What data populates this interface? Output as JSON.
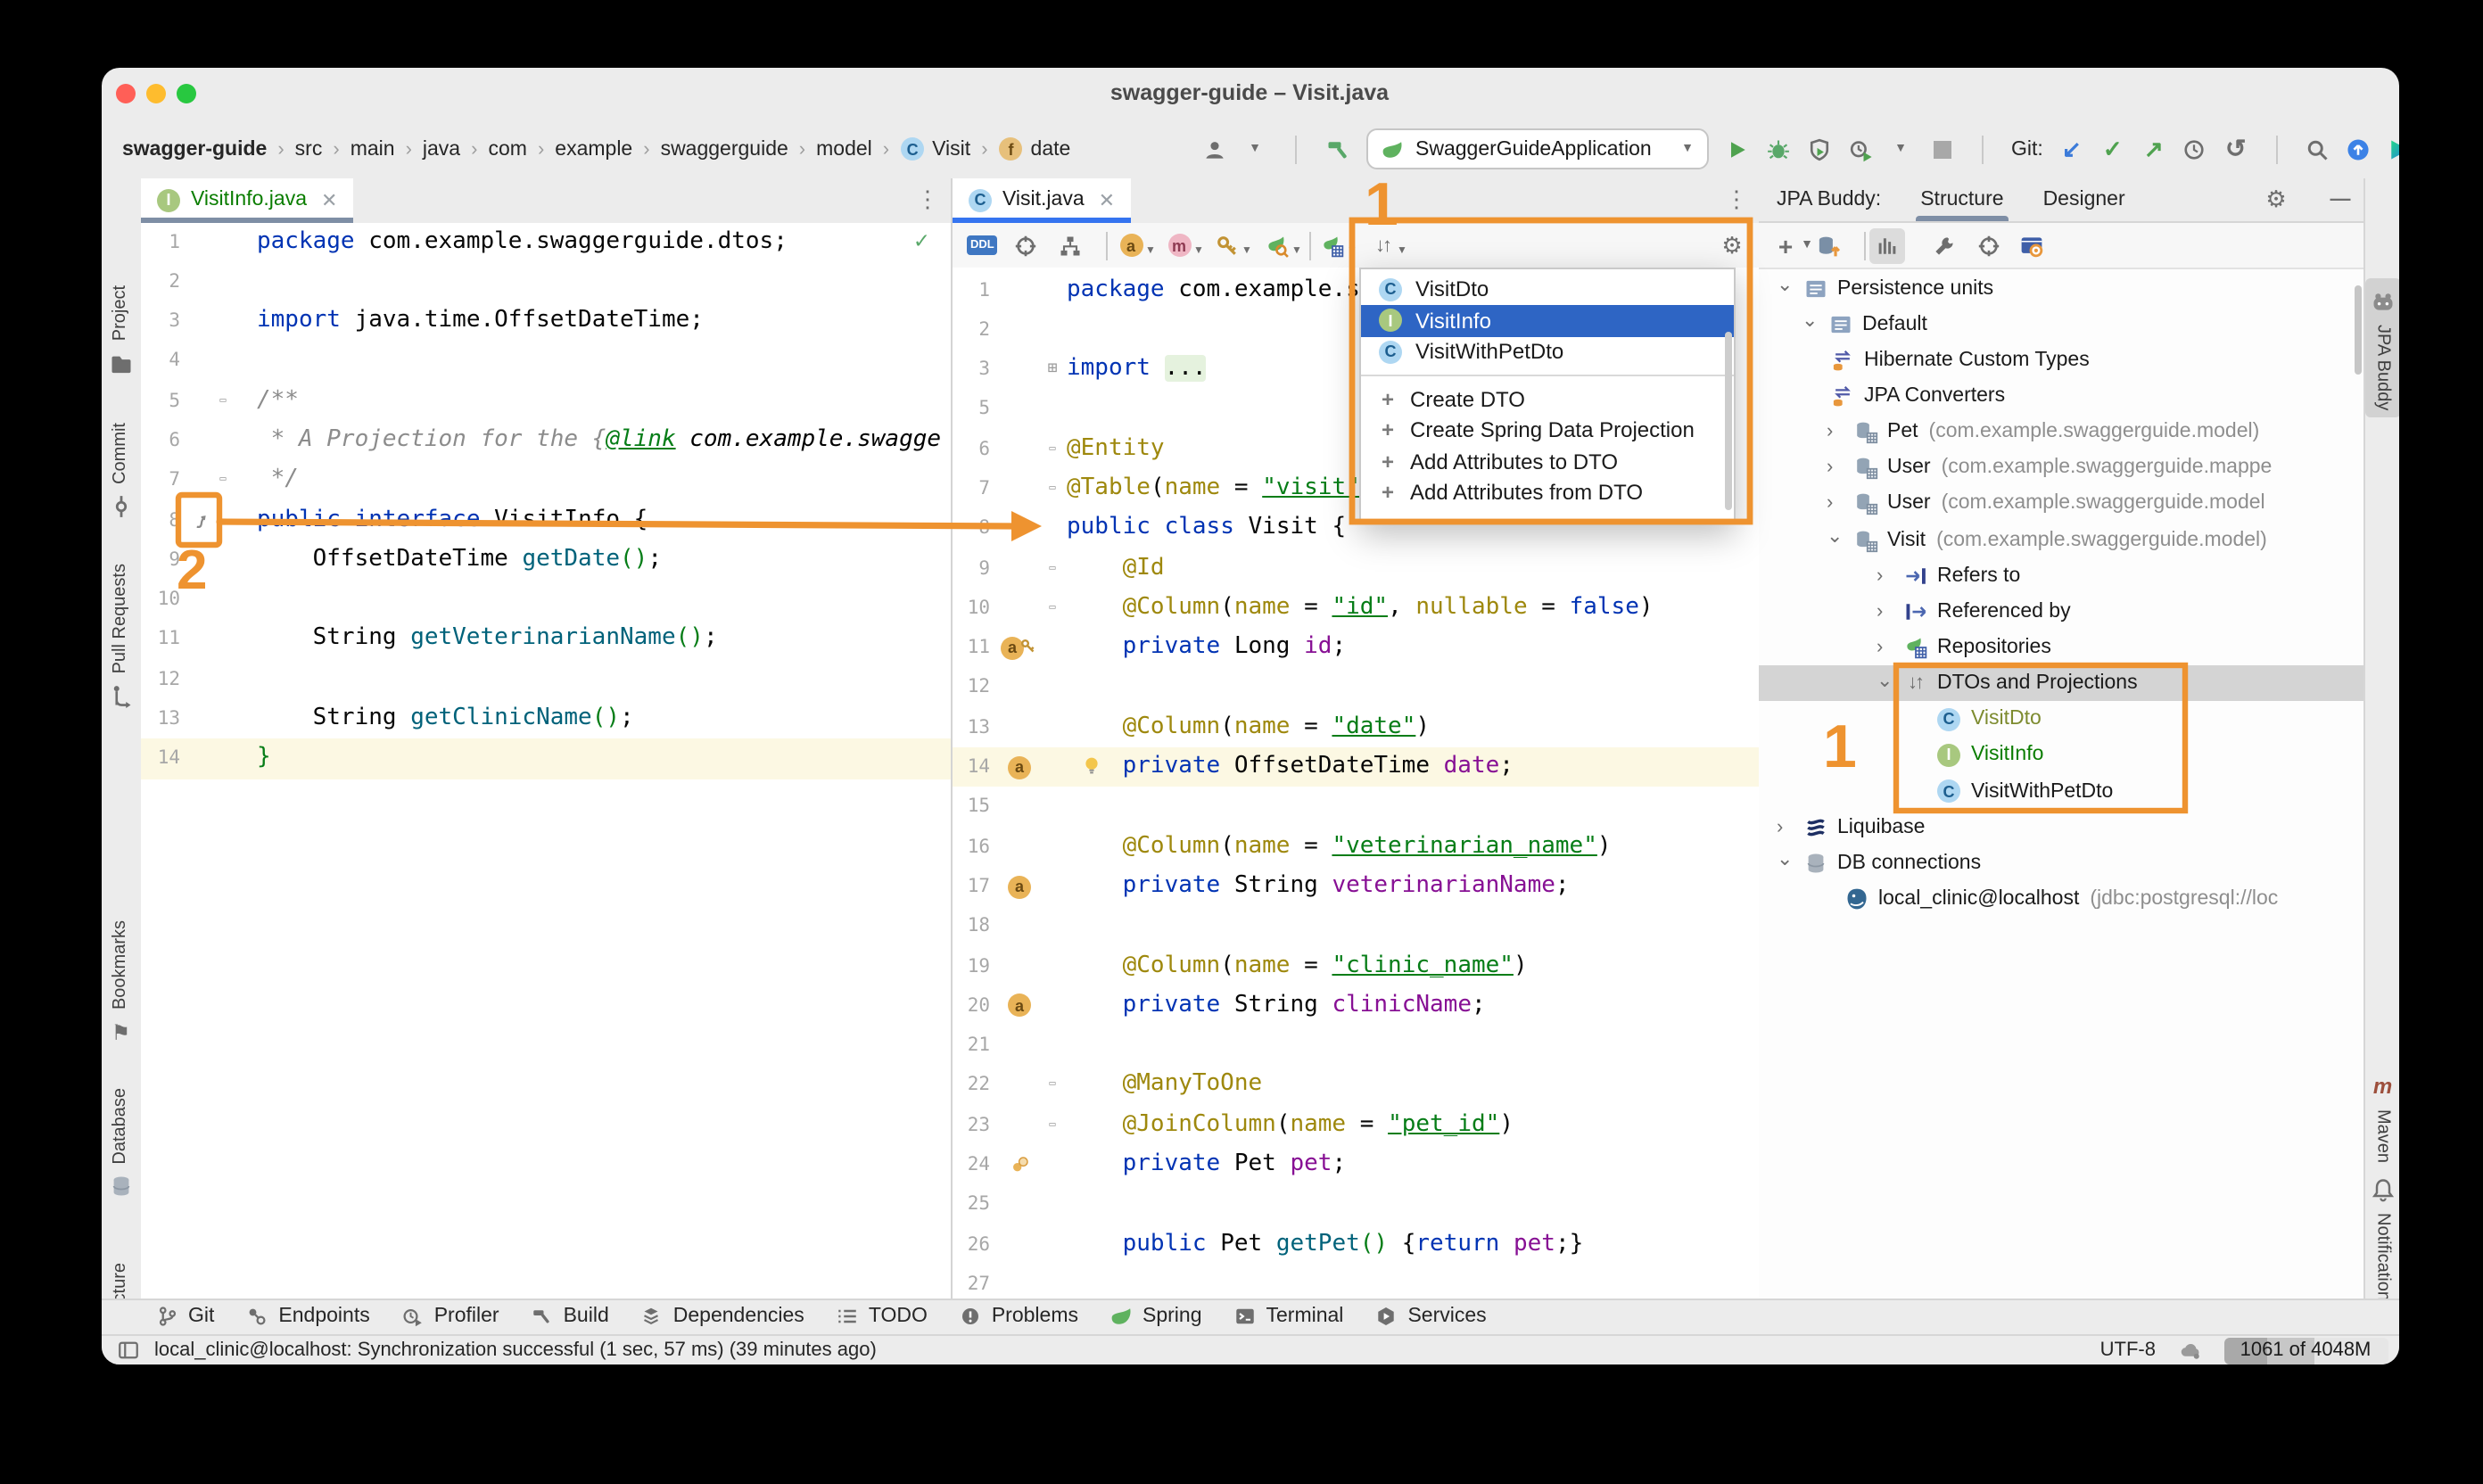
{
  "window_title": "swagger-guide – Visit.java",
  "breadcrumbs": [
    {
      "label": "swagger-guide",
      "bold": true
    },
    {
      "label": "src"
    },
    {
      "label": "main"
    },
    {
      "label": "java"
    },
    {
      "label": "com"
    },
    {
      "label": "example"
    },
    {
      "label": "swaggerguide"
    },
    {
      "label": "model"
    },
    {
      "label": "Visit",
      "icon": "class-c"
    },
    {
      "label": "date",
      "icon": "field-f"
    }
  ],
  "toolbar": {
    "git_label": "Git:",
    "run_config": "SwaggerGuideApplication"
  },
  "left_stripe": [
    {
      "label": "Project",
      "icon": "folder"
    },
    {
      "label": "Commit",
      "icon": "commit"
    },
    {
      "label": "Pull Requests",
      "icon": "pull-request"
    },
    {
      "label": "Bookmarks",
      "icon": "bookmark"
    },
    {
      "label": "Database",
      "icon": "db"
    },
    {
      "label": "Structure",
      "icon": "structure"
    }
  ],
  "right_stripe": [
    {
      "label": "JPA Buddy",
      "icon": "jpa-buddy",
      "selected": true
    },
    {
      "label": "Maven",
      "icon": "maven"
    },
    {
      "label": "Notifications",
      "icon": "bell"
    }
  ],
  "left_editor": {
    "tab": "VisitInfo.java",
    "lines": [
      {
        "n": "1",
        "t": [
          [
            "k",
            "package"
          ],
          [
            "d",
            " com.example.swaggerguide.dtos;"
          ]
        ],
        "check": true
      },
      {
        "n": "2",
        "t": []
      },
      {
        "n": "3",
        "t": [
          [
            "k",
            "import"
          ],
          [
            "d",
            " java.time.OffsetDateTime;"
          ]
        ]
      },
      {
        "n": "4",
        "t": []
      },
      {
        "n": "5",
        "t": [
          [
            "c",
            "/**"
          ]
        ],
        "fold": "-"
      },
      {
        "n": "6",
        "t": [
          [
            "c",
            " * A Projection for the {"
          ],
          [
            "lk",
            "@link"
          ],
          [
            "it",
            " com.example.swagge"
          ]
        ]
      },
      {
        "n": "7",
        "t": [
          [
            "c",
            " */"
          ]
        ],
        "fold": "-"
      },
      {
        "n": "8",
        "t": [
          [
            "k",
            "public"
          ],
          [
            "d",
            " "
          ],
          [
            "k",
            "interface"
          ],
          [
            "d",
            " VisitInfo {"
          ]
        ],
        "badge": "snav"
      },
      {
        "n": "9",
        "t": [
          [
            "d",
            "    OffsetDateTime "
          ],
          [
            "m",
            "getDate"
          ],
          [
            "p",
            "()"
          ],
          [
            "d",
            ";"
          ]
        ]
      },
      {
        "n": "10",
        "t": []
      },
      {
        "n": "11",
        "t": [
          [
            "d",
            "    String "
          ],
          [
            "m",
            "getVeterinarianName"
          ],
          [
            "p",
            "()"
          ],
          [
            "d",
            ";"
          ]
        ]
      },
      {
        "n": "12",
        "t": []
      },
      {
        "n": "13",
        "t": [
          [
            "d",
            "    String "
          ],
          [
            "m",
            "getClinicName"
          ],
          [
            "p",
            "()"
          ],
          [
            "d",
            ";"
          ]
        ]
      },
      {
        "n": "14",
        "t": [
          [
            "p",
            "}"
          ]
        ],
        "hl": true
      }
    ]
  },
  "right_editor": {
    "tab": "Visit.java",
    "lines": [
      {
        "n": "1",
        "t": [
          [
            "k",
            "package"
          ],
          [
            "d",
            " com.example.s"
          ]
        ]
      },
      {
        "n": "2",
        "t": []
      },
      {
        "n": "3",
        "t": [
          [
            "k",
            "import "
          ],
          [
            "fold",
            "..."
          ]
        ],
        "fold": "+"
      },
      {
        "n": "5",
        "t": []
      },
      {
        "n": "6",
        "t": [
          [
            "a",
            "@Entity"
          ]
        ],
        "fold": "-"
      },
      {
        "n": "7",
        "t": [
          [
            "a",
            "@Table"
          ],
          [
            "d",
            "("
          ],
          [
            "a",
            "name"
          ],
          [
            "d",
            " = "
          ],
          [
            "su",
            "\"visit\""
          ]
        ],
        "fold": "-"
      },
      {
        "n": "8",
        "t": [
          [
            "k",
            "public"
          ],
          [
            "d",
            " "
          ],
          [
            "k",
            "class"
          ],
          [
            "d",
            " Visit {"
          ]
        ],
        "badge": "dbtable"
      },
      {
        "n": "9",
        "t": [
          [
            "a",
            "    @Id"
          ]
        ],
        "fold": "-"
      },
      {
        "n": "10",
        "t": [
          [
            "a",
            "    @Column"
          ],
          [
            "d",
            "("
          ],
          [
            "a",
            "name"
          ],
          [
            "d",
            " = "
          ],
          [
            "su",
            "\"id\""
          ],
          [
            "d",
            ", "
          ],
          [
            "a",
            "nullable"
          ],
          [
            "d",
            " = "
          ],
          [
            "k",
            "false"
          ],
          [
            "d",
            ")"
          ]
        ],
        "fold": "-"
      },
      {
        "n": "11",
        "t": [
          [
            "k",
            "    private"
          ],
          [
            "d",
            " Long "
          ],
          [
            "f",
            "id"
          ],
          [
            "d",
            ";"
          ]
        ],
        "badge": "a-key"
      },
      {
        "n": "12",
        "t": []
      },
      {
        "n": "13",
        "t": [
          [
            "a",
            "    @Column"
          ],
          [
            "d",
            "("
          ],
          [
            "a",
            "name"
          ],
          [
            "d",
            " = "
          ],
          [
            "su",
            "\"date\""
          ],
          [
            "d",
            ")"
          ]
        ]
      },
      {
        "n": "14",
        "t": [
          [
            "k",
            "    private"
          ],
          [
            "d",
            " OffsetDateTime "
          ],
          [
            "f",
            "date"
          ],
          [
            "d",
            ";"
          ]
        ],
        "hl": true,
        "badge": "a",
        "bulb": true
      },
      {
        "n": "15",
        "t": []
      },
      {
        "n": "16",
        "t": [
          [
            "a",
            "    @Column"
          ],
          [
            "d",
            "("
          ],
          [
            "a",
            "name"
          ],
          [
            "d",
            " = "
          ],
          [
            "su",
            "\"veterinarian_name\""
          ],
          [
            "d",
            ")"
          ]
        ]
      },
      {
        "n": "17",
        "t": [
          [
            "k",
            "    private"
          ],
          [
            "d",
            " String "
          ],
          [
            "f",
            "veterinarianName"
          ],
          [
            "d",
            ";"
          ]
        ],
        "badge": "a"
      },
      {
        "n": "18",
        "t": []
      },
      {
        "n": "19",
        "t": [
          [
            "a",
            "    @Column"
          ],
          [
            "d",
            "("
          ],
          [
            "a",
            "name"
          ],
          [
            "d",
            " = "
          ],
          [
            "su",
            "\"clinic_name\""
          ],
          [
            "d",
            ")"
          ]
        ]
      },
      {
        "n": "20",
        "t": [
          [
            "k",
            "    private"
          ],
          [
            "d",
            " String "
          ],
          [
            "f",
            "clinicName"
          ],
          [
            "d",
            ";"
          ]
        ],
        "badge": "a"
      },
      {
        "n": "21",
        "t": []
      },
      {
        "n": "22",
        "t": [
          [
            "a",
            "    @ManyToOne"
          ]
        ],
        "fold": "-"
      },
      {
        "n": "23",
        "t": [
          [
            "a",
            "    @JoinColumn"
          ],
          [
            "d",
            "("
          ],
          [
            "a",
            "name"
          ],
          [
            "d",
            " = "
          ],
          [
            "su",
            "\"pet_id\""
          ],
          [
            "d",
            ")"
          ]
        ],
        "fold": "-"
      },
      {
        "n": "24",
        "t": [
          [
            "k",
            "    private"
          ],
          [
            "d",
            " Pet "
          ],
          [
            "f",
            "pet"
          ],
          [
            "d",
            ";"
          ]
        ],
        "badge": "link"
      },
      {
        "n": "25",
        "t": []
      },
      {
        "n": "26",
        "t": [
          [
            "k",
            "    public"
          ],
          [
            "d",
            " Pet "
          ],
          [
            "m",
            "getPet"
          ],
          [
            "p",
            "()"
          ],
          [
            "d",
            " {"
          ],
          [
            "k",
            "return"
          ],
          [
            "d",
            " "
          ],
          [
            "f",
            "pet"
          ],
          [
            "d",
            ";}"
          ]
        ]
      },
      {
        "n": "27",
        "t": []
      }
    ]
  },
  "popup": {
    "classes": [
      {
        "label": "VisitDto",
        "icon": "class-c"
      },
      {
        "label": "VisitInfo",
        "icon": "interface-i",
        "selected": true
      },
      {
        "label": "VisitWithPetDto",
        "icon": "class-c"
      }
    ],
    "actions": [
      "Create DTO",
      "Create Spring Data Projection",
      "Add Attributes to DTO",
      "Add Attributes from DTO"
    ]
  },
  "jpa_panel": {
    "title": "JPA Buddy:",
    "tabs": [
      "Structure",
      "Designer"
    ],
    "tree": [
      {
        "level": 0,
        "chevron": "v",
        "icon": "punit",
        "label": "Persistence units"
      },
      {
        "level": 1,
        "chevron": "v",
        "icon": "punit",
        "label": "Default"
      },
      {
        "level": 2,
        "chevron": "",
        "icon": "converter",
        "label": "Hibernate Custom Types"
      },
      {
        "level": 2,
        "chevron": "",
        "icon": "converter",
        "label": "JPA Converters"
      },
      {
        "level": 2,
        "chevron": ">",
        "icon": "entity",
        "label": "Pet",
        "suffix": "(com.example.swaggerguide.model)"
      },
      {
        "level": 2,
        "chevron": ">",
        "icon": "entity",
        "label": "User",
        "suffix": "(com.example.swaggerguide.mappe"
      },
      {
        "level": 2,
        "chevron": ">",
        "icon": "entity",
        "label": "User",
        "suffix": "(com.example.swaggerguide.model"
      },
      {
        "level": 2,
        "chevron": "v",
        "icon": "entity",
        "label": "Visit",
        "suffix": "(com.example.swaggerguide.model)"
      },
      {
        "level": 3,
        "chevron": ">",
        "icon": "refers",
        "label": "Refers to"
      },
      {
        "level": 3,
        "chevron": ">",
        "icon": "refby",
        "label": "Referenced by"
      },
      {
        "level": 3,
        "chevron": ">",
        "icon": "leaf-table",
        "label": "Repositories"
      },
      {
        "level": 3,
        "chevron": "v",
        "icon": "sort",
        "label": "DTOs and Projections",
        "selected": true
      },
      {
        "level": 4,
        "chevron": "",
        "icon": "class-c",
        "label": "VisitDto",
        "color": "#7D8B2F"
      },
      {
        "level": 4,
        "chevron": "",
        "icon": "interface-i",
        "label": "VisitInfo",
        "color": "#0A7D00"
      },
      {
        "level": 4,
        "chevron": "",
        "icon": "class-c",
        "label": "VisitWithPetDto"
      },
      {
        "level": 0,
        "chevron": ">",
        "icon": "liquibase",
        "label": "Liquibase"
      },
      {
        "level": 0,
        "chevron": "v",
        "icon": "db",
        "label": "DB connections"
      },
      {
        "level": 2,
        "chevron": "",
        "icon": "postgres",
        "label": "local_clinic@localhost",
        "suffix": "(jdbc:postgresql://loc",
        "ipad": 8
      }
    ]
  },
  "bottom_bar": [
    {
      "label": "Git",
      "icon": "git-branch"
    },
    {
      "label": "Endpoints",
      "icon": "endpoints"
    },
    {
      "label": "Profiler",
      "icon": "profiler2"
    },
    {
      "label": "Build",
      "icon": "build"
    },
    {
      "label": "Dependencies",
      "icon": "dependencies"
    },
    {
      "label": "TODO",
      "icon": "todo"
    },
    {
      "label": "Problems",
      "icon": "problems"
    },
    {
      "label": "Spring",
      "icon": "spring"
    },
    {
      "label": "Terminal",
      "icon": "terminal"
    },
    {
      "label": "Services",
      "icon": "services"
    }
  ],
  "status_bar": {
    "message": "local_clinic@localhost: Synchronization successful (1 sec, 57 ms) (39 minutes ago)",
    "encoding": "UTF-8",
    "memory": "1061 of 4048M"
  },
  "annotations": {
    "one": "1",
    "two": "2",
    "panel_one": "1"
  },
  "colors": {
    "accent_orange": "#EE9330",
    "popup_selection": "#2E65C4",
    "tab_active_blue": "#3574F0",
    "tab_inactive_underline": "#7E8EA5",
    "added_file_green": "#0A7D00",
    "traffic_red": "#FF5F57",
    "traffic_yellow": "#FEBC2E",
    "traffic_green": "#28C840"
  }
}
